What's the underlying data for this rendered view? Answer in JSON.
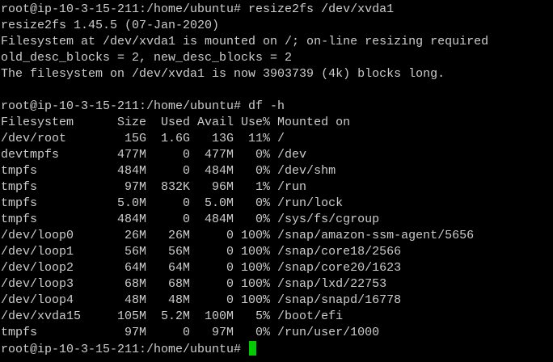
{
  "terminal": {
    "lines": [
      "root@ip-10-3-15-211:/home/ubuntu# resize2fs /dev/xvda1",
      "resize2fs 1.45.5 (07-Jan-2020)",
      "Filesystem at /dev/xvda1 is mounted on /; on-line resizing required",
      "old_desc_blocks = 2, new_desc_blocks = 2",
      "The filesystem on /dev/xvda1 is now 3903739 (4k) blocks long.",
      "",
      "root@ip-10-3-15-211:/home/ubuntu# df -h",
      "Filesystem      Size  Used Avail Use% Mounted on",
      "/dev/root        15G  1.6G   13G  11% /",
      "devtmpfs        477M     0  477M   0% /dev",
      "tmpfs           484M     0  484M   0% /dev/shm",
      "tmpfs            97M  832K   96M   1% /run",
      "tmpfs           5.0M     0  5.0M   0% /run/lock",
      "tmpfs           484M     0  484M   0% /sys/fs/cgroup",
      "/dev/loop0       26M   26M     0 100% /snap/amazon-ssm-agent/5656",
      "/dev/loop1       56M   56M     0 100% /snap/core18/2566",
      "/dev/loop2       64M   64M     0 100% /snap/core20/1623",
      "/dev/loop3       68M   68M     0 100% /snap/lxd/22753",
      "/dev/loop4       48M   48M     0 100% /snap/snapd/16778",
      "/dev/xvda15     105M  5.2M  100M   5% /boot/efi",
      "tmpfs            97M     0   97M   0% /run/user/1000"
    ],
    "prompt": "root@ip-10-3-15-211:/home/ubuntu# ",
    "colors": {
      "background": "#000000",
      "text": "#cccccc",
      "cursor": "#00cc00"
    }
  }
}
